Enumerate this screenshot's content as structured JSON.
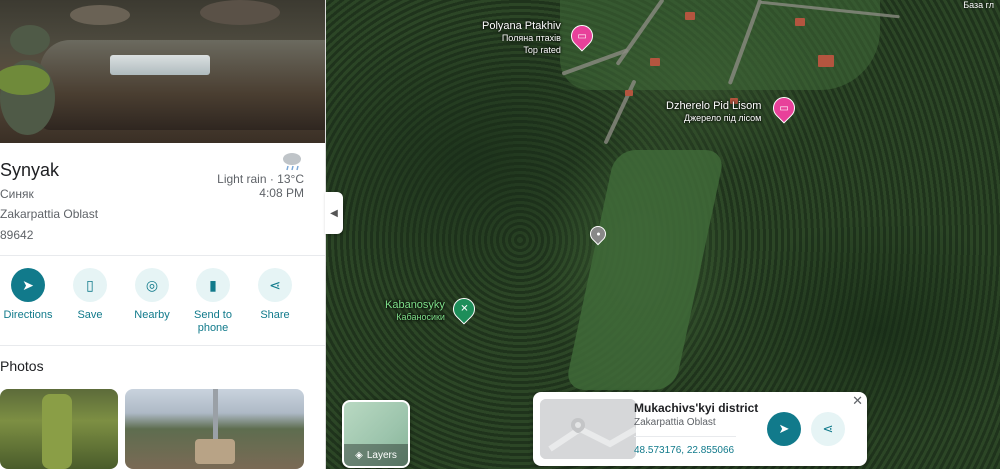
{
  "map": {
    "corner_label": "База гл",
    "places": [
      {
        "name": "Polyana Ptakhiv",
        "native": "Поляна птахів",
        "note": "Top rated"
      },
      {
        "name": "Dzherelo Pid Lisom",
        "native": "Джерело під лісом"
      },
      {
        "name": "Kabanosyky",
        "native": "Кабаносики"
      }
    ],
    "layers_label": "Layers"
  },
  "panel": {
    "title": "Synyak",
    "native_name": "Синяк",
    "region": "Zakarpattia Oblast",
    "postal_code": "89642",
    "weather": {
      "condition": "Light rain · 13°C",
      "time": "4:08 PM",
      "icon": "rain-cloud-icon"
    },
    "actions": [
      {
        "label": "Directions",
        "icon": "directions-icon"
      },
      {
        "label": "Save",
        "icon": "bookmark-icon"
      },
      {
        "label": "Nearby",
        "icon": "nearby-icon"
      },
      {
        "label": "Send to phone",
        "icon": "send-to-phone-icon"
      },
      {
        "label": "Share",
        "icon": "share-icon"
      }
    ],
    "photos_heading": "Photos"
  },
  "card": {
    "title": "Mukachivs'kyi district",
    "subtitle": "Zakarpattia Oblast",
    "coordinates": "48.573176, 22.855066"
  },
  "colors": {
    "accent": "#117a8b",
    "accent_light": "#e6f4f5",
    "pin_pink": "#e8419a",
    "pin_green": "#1e8e5a"
  }
}
